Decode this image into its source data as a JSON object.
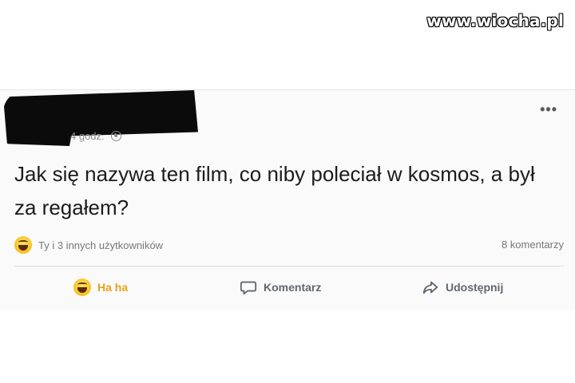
{
  "watermark": "www.wiocha.pl",
  "post": {
    "time": "4 godz.",
    "more_label": "•••",
    "text": "Jak się nazywa ten film, co niby poleciał w kosmos, a był za regałem?",
    "reactions_text": "Ty i 3 innych użytkowników",
    "comments_count": "8 komentarzy",
    "actions": {
      "haha": "Ha ha",
      "comment": "Komentarz",
      "share": "Udostępnij"
    }
  },
  "colors": {
    "haha_active": "#e8a21a",
    "action_gray": "#606770"
  },
  "icons": [
    "globe-icon",
    "haha-emoji-icon",
    "comment-icon",
    "share-icon",
    "more-options-icon"
  ]
}
